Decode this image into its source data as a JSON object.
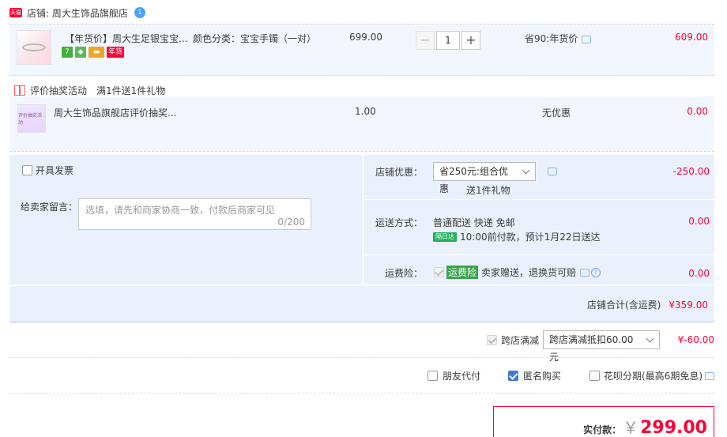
{
  "store": {
    "tmall_tag": "天猫",
    "name": "店铺: 周大生饰品旗舰店",
    "ww_badge": "1"
  },
  "item1": {
    "title": "【年货价】周大生足银宝宝...",
    "sku": "颜色分类：宝宝手镯（一对）",
    "price": "699.00",
    "quantity": "1",
    "minus": "−",
    "plus": "+",
    "discount": "省90:年货价",
    "total": "609.00",
    "badges": [
      "7",
      "",
      "",
      "年货"
    ]
  },
  "promo": {
    "activity": "评价抽奖活动",
    "rule": "满1件送1件礼物"
  },
  "item2": {
    "title": "周大生饰品旗舰店评价抽奖...",
    "thumb_text": "评价抽奖活动",
    "price": "1.00",
    "discount": "无优惠",
    "total": "0.00"
  },
  "invoice": {
    "label": "开具发票"
  },
  "message": {
    "label": "给卖家留言：",
    "placeholder": "选填，请先和商家协商一致，付款后商家可见",
    "counter": "0/200"
  },
  "store_discount": {
    "label": "店铺优惠：",
    "selected": "省250元:组合优惠",
    "gift": "送1件礼物",
    "amount": "-250.00"
  },
  "shipping": {
    "label": "运送方式：",
    "method": "普通配送 快递 免邮",
    "badge": "隔日达",
    "eta": "10:00前付款，预计1月22日送达",
    "amount": "0.00"
  },
  "freight_insurance": {
    "label": "运费险：",
    "tag": "运费险",
    "text": "卖家赠送，退换货可赔",
    "help": "?",
    "amount": "0.00"
  },
  "store_total": {
    "label": "店铺合计(含运费)",
    "amount": "¥359.00"
  },
  "cross_store": {
    "label": "跨店满减",
    "selected": "跨店满减抵扣60.00元",
    "amount": "¥-60.00"
  },
  "options": {
    "friend_pay": "朋友代付",
    "anonymous": "匿名购买",
    "huabei": "花呗分期(最高6期免息)"
  },
  "payment": {
    "label": "实付款：",
    "currency": "￥",
    "amount": "299.00"
  },
  "colors": {
    "accent_red": "#ff0036",
    "row_bg": "#f2f7ff",
    "section_bg": "#eaf1fc",
    "checkbox_blue": "#3d7cd6"
  }
}
